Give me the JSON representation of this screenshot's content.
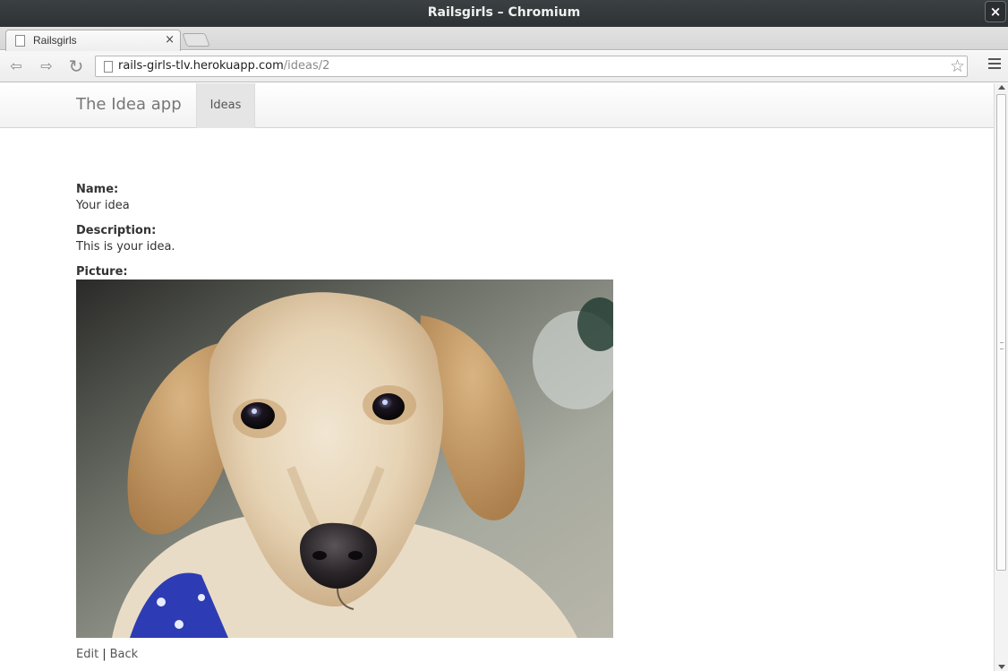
{
  "window": {
    "title": "Railsgirls – Chromium",
    "close_glyph": "×"
  },
  "tab": {
    "label": "Railsgirls",
    "close_glyph": "×",
    "icon": "page-icon"
  },
  "toolbar": {
    "url_host": "rails-girls-tlv.herokuapp.com",
    "url_path": "/ideas/2",
    "back_glyph": "⇦",
    "forward_glyph": "⇨",
    "reload_glyph": "↻",
    "star_glyph": "☆"
  },
  "navbar": {
    "brand": "The Idea app",
    "ideas_link": "Ideas"
  },
  "idea": {
    "name_label": "Name:",
    "name_value": "Your idea",
    "description_label": "Description:",
    "description_value": "This is your idea.",
    "picture_label": "Picture:"
  },
  "actions": {
    "edit": "Edit",
    "separator": "|",
    "back": "Back"
  },
  "colors": {
    "titlebar": "#2d3234",
    "navbar_active": "#e5e5e5",
    "text": "#333333",
    "link": "#555555"
  }
}
